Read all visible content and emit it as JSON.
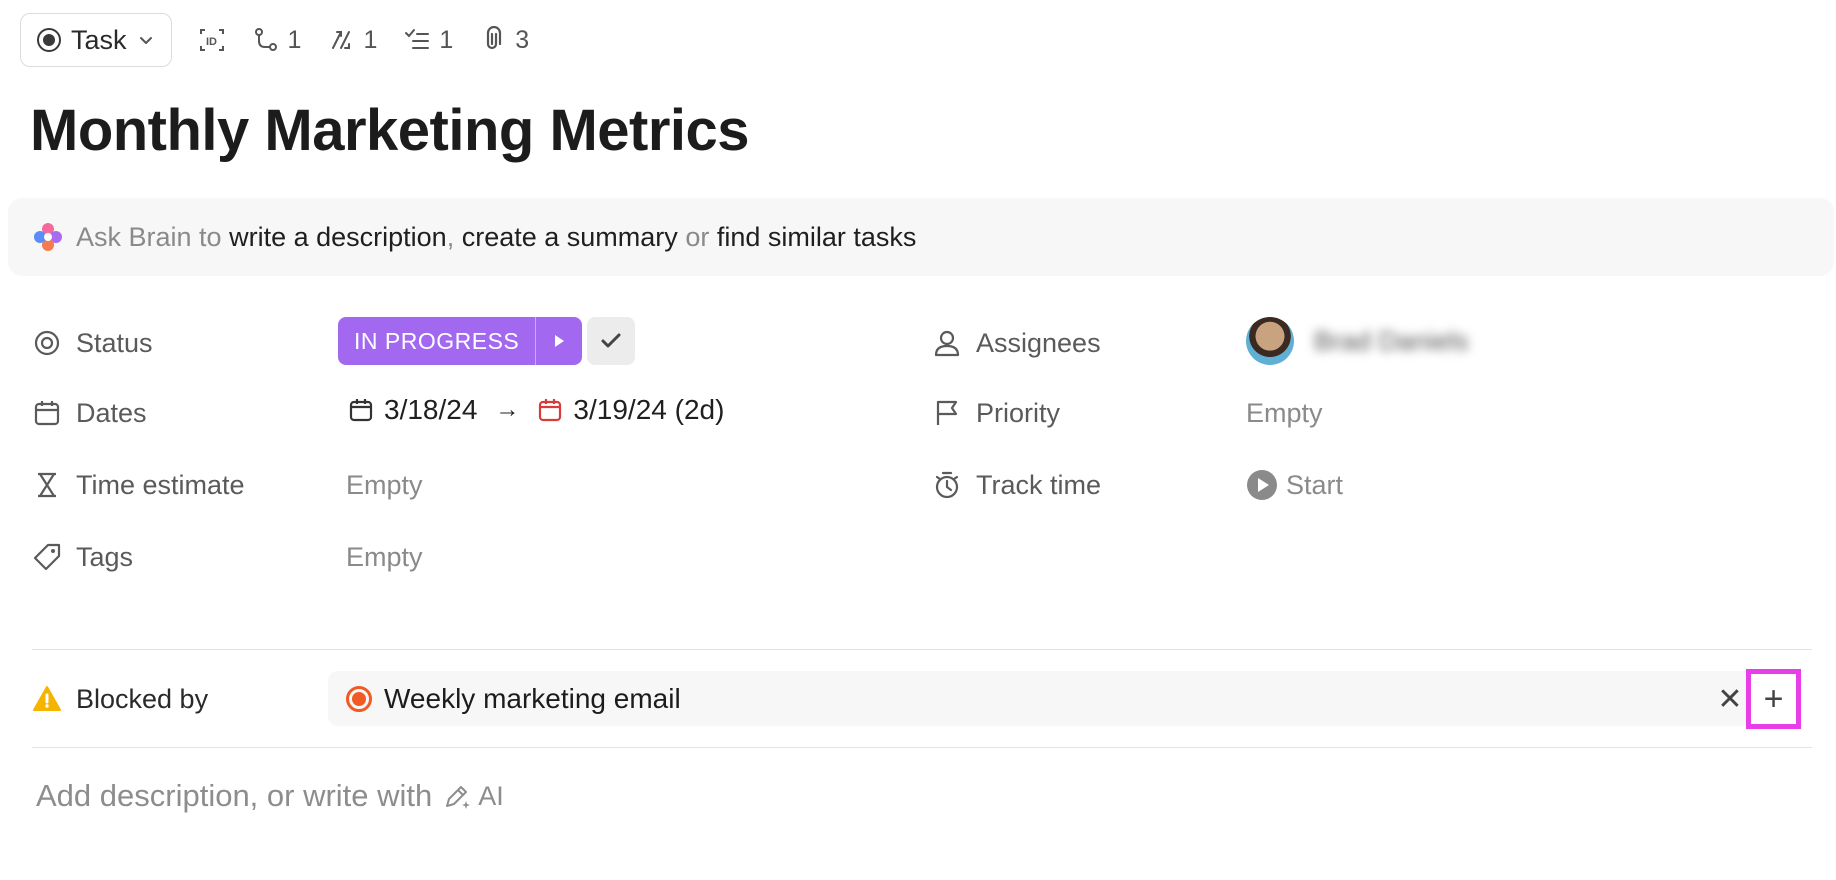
{
  "toolbar": {
    "type_label": "Task",
    "dependencies_count": "1",
    "subtasks_count": "1",
    "checklist_count": "1",
    "attachments_count": "3"
  },
  "task": {
    "title": "Monthly Marketing Metrics"
  },
  "brain": {
    "prefix": "Ask Brain to",
    "action1": "write a description",
    "sep1": ",",
    "action2": "create a summary",
    "sep2": "or",
    "action3": "find similar tasks"
  },
  "fields": {
    "status_label": "Status",
    "status_value": "IN PROGRESS",
    "dates_label": "Dates",
    "start_date": "3/18/24",
    "arrow": "→",
    "due_date": "3/19/24 (2d)",
    "time_estimate_label": "Time estimate",
    "time_estimate_value": "Empty",
    "tags_label": "Tags",
    "tags_value": "Empty",
    "assignees_label": "Assignees",
    "assignee_name": "Brad Daniels",
    "priority_label": "Priority",
    "priority_value": "Empty",
    "track_time_label": "Track time",
    "track_time_value": "Start"
  },
  "blocked": {
    "label": "Blocked by",
    "task_name": "Weekly marketing email",
    "remove_symbol": "✕",
    "add_symbol": "+"
  },
  "description": {
    "placeholder": "Add description, or write with",
    "ai_label": "AI"
  },
  "colors": {
    "status": "#a368f0",
    "blocked_task": "#f15a24",
    "highlight": "#e83de8",
    "warning": "#f5b400",
    "due_date": "#d93a3a"
  },
  "icons": [
    "type-dot-icon",
    "task-id-icon",
    "dependency-icon",
    "subtasks-icon",
    "checklist-icon",
    "attachment-icon",
    "brain-icon",
    "status-icon",
    "calendar-icon",
    "hourglass-icon",
    "tag-icon",
    "person-icon",
    "flag-icon",
    "stopwatch-icon",
    "play-icon",
    "warning-icon",
    "pencil-ai-icon"
  ]
}
